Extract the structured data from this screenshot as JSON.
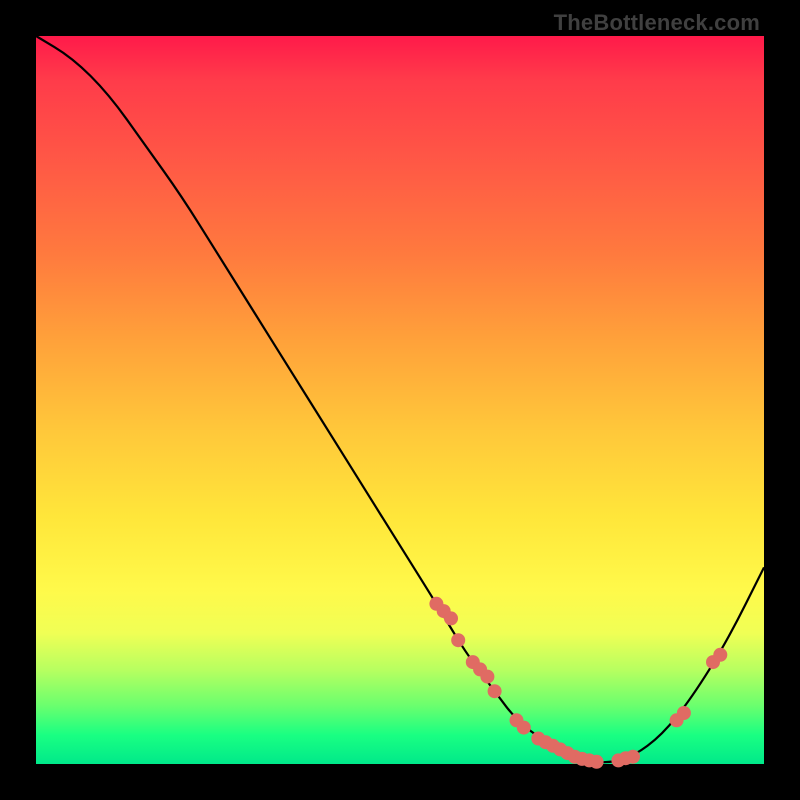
{
  "watermark": "TheBottleneck.com",
  "colors": {
    "background_black": "#000000",
    "dot_color": "#e06b63",
    "line_color": "#000000",
    "gradient_top": "#ff1a4a",
    "gradient_bottom": "#00e98a"
  },
  "chart_data": {
    "type": "line",
    "title": "",
    "xlabel": "",
    "ylabel": "",
    "xlim": [
      0,
      100
    ],
    "ylim": [
      0,
      100
    ],
    "x": [
      0,
      5,
      10,
      15,
      20,
      25,
      30,
      35,
      40,
      45,
      50,
      55,
      58,
      60,
      63,
      66,
      70,
      74,
      78,
      82,
      86,
      90,
      95,
      100
    ],
    "y": [
      100,
      97,
      92,
      85,
      78,
      70,
      62,
      54,
      46,
      38,
      30,
      22,
      17,
      14,
      10,
      6,
      3,
      1,
      0,
      1,
      4,
      9,
      17,
      27
    ],
    "markers_x": [
      55,
      56,
      57,
      58,
      60,
      61,
      62,
      63,
      66,
      67,
      69,
      70,
      71,
      72,
      73,
      74,
      75,
      76,
      77,
      80,
      81,
      82,
      88,
      89,
      93,
      94
    ],
    "markers_y": [
      22,
      21,
      20,
      17,
      14,
      13,
      12,
      10,
      6,
      5,
      3.5,
      3,
      2.5,
      2,
      1.5,
      1,
      0.7,
      0.5,
      0.3,
      0.5,
      0.8,
      1,
      6,
      7,
      14,
      15
    ],
    "notes": "V-shaped bottleneck curve overlaid on red-to-green vertical gradient. Dots are data markers clustered on the descending slope around x=55–77 and a few on the ascending slope around x=80–94. No axis ticks or labels are shown."
  }
}
